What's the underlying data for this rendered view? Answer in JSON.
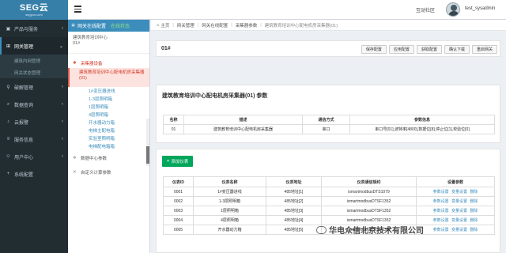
{
  "sidebar": {
    "logo_main": "SEG云",
    "logo_sub": "segyun.com",
    "items": [
      {
        "label": "产品与服务",
        "icon": "cube-icon",
        "active": false
      },
      {
        "label": "网关管理",
        "icon": "network-icon",
        "active": true
      },
      {
        "label": "破解管理",
        "icon": "link-icon",
        "active": false
      },
      {
        "label": "数据查询",
        "icon": "search-icon",
        "active": false
      },
      {
        "label": "云报警",
        "icon": "bell-icon",
        "active": false
      },
      {
        "label": "服务信息",
        "icon": "list-icon",
        "active": false
      },
      {
        "label": "用户中心",
        "icon": "user-icon",
        "active": false
      },
      {
        "label": "系统配置",
        "icon": "plus-icon",
        "active": false
      }
    ],
    "sub_items": [
      "建筑内网管理",
      "网关状态管理"
    ]
  },
  "header": {
    "community": "互动社区",
    "username": "test_sysadmin"
  },
  "tree": {
    "head": "网关在线配置",
    "status": "在线状态",
    "root_name": "建筑教育培训中心",
    "root_id": "01#",
    "collector": "采集器设备",
    "selected": "建筑教育培训中心配电机房采集器(01)",
    "leaves": [
      "1#变压器进线",
      "1-3层照明箱",
      "1层照明箱",
      "4层照明箱",
      "开水器动力箱",
      "电梯主配电箱",
      "实验室照明箱",
      "电梯配电箱箱"
    ],
    "data_center": "数据中心参数",
    "custom": "自定义计算参数"
  },
  "breadcrumb": [
    "主页",
    "网关管理",
    "网关在线配置",
    "采集器参数",
    "建筑教育培训中心配电机房采集器(01)"
  ],
  "title_bar": {
    "title": "01#",
    "buttons": [
      "保存配置",
      "应用配置",
      "获取配置",
      "确认下载",
      "重启网关"
    ]
  },
  "info_panel": {
    "title": "建筑教育培训中心配电机房采集器(01) 参数",
    "headers": [
      "名称",
      "描述",
      "通信方式",
      "参数信息"
    ],
    "row": [
      "01",
      "建筑教育培训中心配电机房采集器",
      "串口",
      "串口号[01],波特率[4800],数据位[8],停止位[1],校验位[0]"
    ]
  },
  "gateway_panel": {
    "add_label": "添加仪表",
    "headers": [
      "仪表ID",
      "仪表名称",
      "仪表地址",
      "仪表通信规约",
      "设置参数"
    ],
    "rows": [
      [
        "0001",
        "1#变压器进线",
        "485地址[1]",
        "ismartmodbusDTS1079"
      ],
      [
        "0002",
        "1-3层照明箱",
        "485地址[2]",
        "ismartmodbusDTSF1352"
      ],
      [
        "0003",
        "1层照明箱",
        "485地址[3]",
        "ismartmodbusDTSF1352"
      ],
      [
        "0004",
        "4层照明箱",
        "485地址[4]",
        "ismartmodbusDTSF1352"
      ],
      [
        "0005",
        "开水器动力箱",
        "485地址[5]",
        "ismartmodbusDTSF1352"
      ]
    ],
    "actions": [
      "参数设置",
      "变量设置",
      "删除"
    ]
  },
  "watermark": "华电众信北京技术有限公司",
  "colors": {
    "sidebar_bg": "#222d32",
    "brand": "#3c8dbc",
    "logo_bg": "#367fa9",
    "add_button": "#00a65a",
    "tree_selected": "#d33c2a"
  }
}
